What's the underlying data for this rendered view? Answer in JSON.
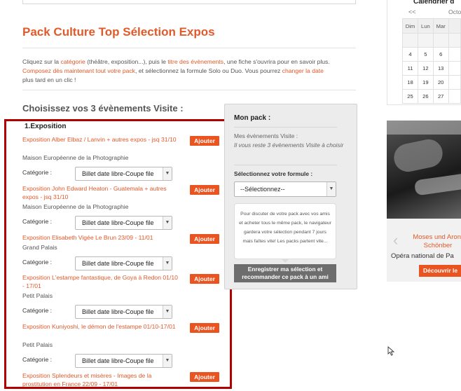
{
  "header": {
    "page_title": "Pack Culture Top Sélection Expos"
  },
  "intro": {
    "t1": "Cliquez sur la ",
    "link_category": "catégorie",
    "t2": " (théâtre, exposition...), puis le ",
    "link_title": "titre des évènements",
    "t3": ", une fiche s'ouvrira pour en savoir plus. ",
    "link_compose": "Composez dès maintenant tout votre pack",
    "t4": ", et sélectionnez la formule Solo ou Duo. Vous pourrez ",
    "link_change_date": "changer la date",
    "t5": " plus tard en un clic !"
  },
  "selection": {
    "title": "Choisissez vos 3 évènements Visite :",
    "section": "1.Exposition",
    "add_label": "Ajouter",
    "category_label": "Catégorie :",
    "events": [
      {
        "title": "Exposition Alber Elbaz / Lanvin + autres expos - jsq 31/10",
        "venue": "Maison Européenne de la Photographie",
        "category_value": "Billet date libre-Coupe file"
      },
      {
        "title": "Exposition John Edward Heaton - Guatemala + autres expos - jsq 31/10",
        "venue": "Maison Européenne de la Photographie",
        "category_value": "Billet date libre-Coupe file"
      },
      {
        "title": "Exposition Elisabeth Vigée Le Brun 23/09 - 11/01",
        "venue": "Grand Palais",
        "category_value": "Billet date libre-Coupe file"
      },
      {
        "title": "Exposition L'estampe fantastique, de Goya à Redon 01/10 - 17/01",
        "venue": "Petit Palais",
        "category_value": "Billet date libre-Coupe file"
      },
      {
        "title": "Exposition Kuniyoshi, le démon de l'estampe 01/10-17/01",
        "venue": "Petit Palais",
        "category_value": "Billet date libre-Coupe file"
      },
      {
        "title": "Exposition Splendeurs et misères - Images de la prostitution en France 22/09 - 17/01",
        "venue": "",
        "category_value": ""
      }
    ]
  },
  "pack": {
    "title": "Mon pack :",
    "count_label": "Mes évènements Visite :",
    "remaining": "Il vous reste 3 évènements Visite à choisir",
    "formula_label": "Sélectionnez votre formule :",
    "formula_value": "--Sélectionnez--",
    "info": "Pour discuter de votre pack avec vos amis et acheter tous le même pack, le navigateur gardera votre sélection pendant 7 jours mais faîtes vite! Les packs partent vite...",
    "save_line1": "Enregistrer ma sélection et",
    "save_line2": "recommander ce pack à un ami"
  },
  "calendar": {
    "title": "Calendrier d",
    "prev": "<<",
    "month": "Octo",
    "weekdays": [
      "Dim",
      "Lun",
      "Mar",
      ""
    ],
    "weeks": [
      [
        "",
        "",
        "",
        ""
      ],
      [
        "4",
        "5",
        "6",
        ""
      ],
      [
        "11",
        "12",
        "13",
        ""
      ],
      [
        "18",
        "19",
        "20",
        ""
      ],
      [
        "25",
        "26",
        "27",
        ""
      ]
    ]
  },
  "featured": {
    "name": "Moses und Aron, Schönber",
    "venue": "Opéra national de Pa",
    "discover": "Découvrir le"
  }
}
